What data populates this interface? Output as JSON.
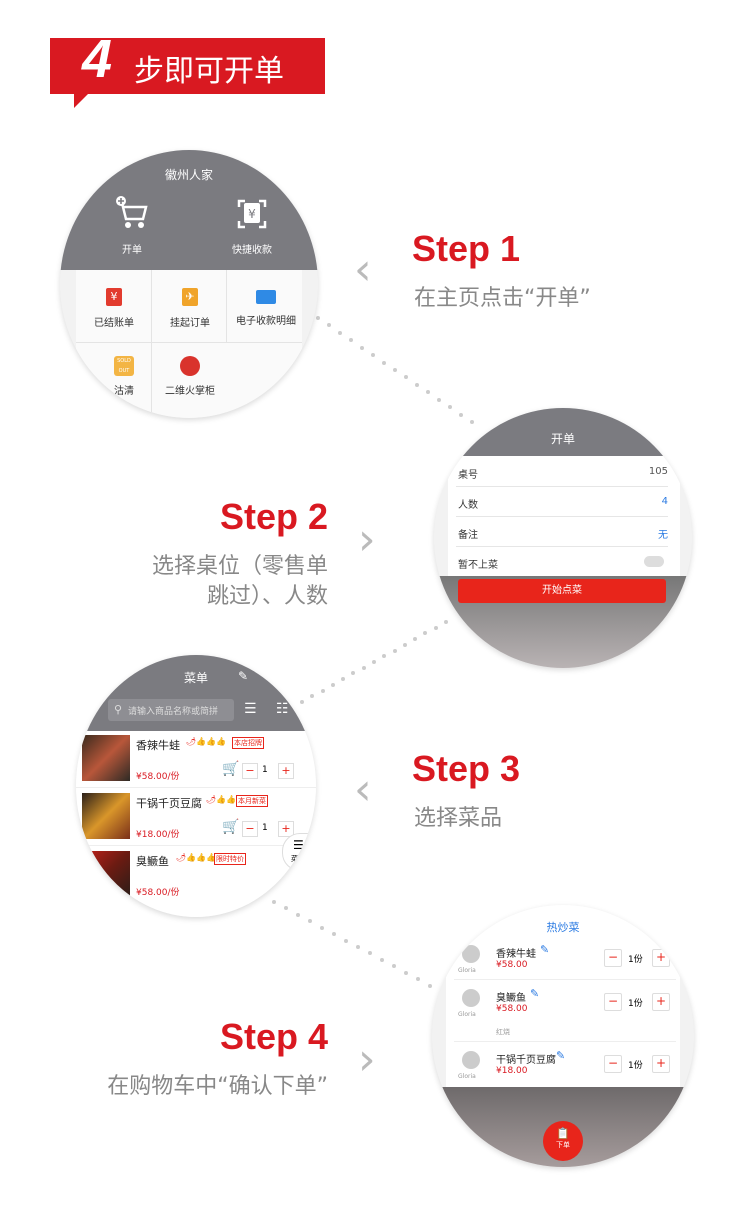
{
  "header": {
    "number": "4",
    "title": "步即可开单",
    "color": "#d91921"
  },
  "steps": [
    {
      "title": "Step 1",
      "desc": "在主页点击“开单”"
    },
    {
      "title": "Step 2",
      "desc_line1": "选择桌位（零售单",
      "desc_line2": "跳过）、人数"
    },
    {
      "title": "Step 3",
      "desc": "选择菜品"
    },
    {
      "title": "Step 4",
      "desc": "在购物车中“确认下单”"
    }
  ],
  "screen1": {
    "store_name": "徽州人家",
    "actions": [
      {
        "label": "开单",
        "icon": "cart-icon"
      },
      {
        "label": "快捷收款",
        "icon": "scan-yuan-icon"
      }
    ],
    "tiles": [
      {
        "label": "已结账单",
        "icon": "yuan-bill-icon"
      },
      {
        "label": "挂起订单",
        "icon": "pin-order-icon"
      },
      {
        "label": "电子收款明细",
        "icon": "card-icon"
      },
      {
        "label": "沽清",
        "icon": "sold-out-icon"
      },
      {
        "label": "二维火掌柜",
        "icon": "fire-icon"
      }
    ],
    "sold_out_text": "SOLD OUT"
  },
  "screen2": {
    "title": "开单",
    "rows": [
      {
        "label": "桌号",
        "value": "105"
      },
      {
        "label": "人数",
        "value": "4"
      },
      {
        "label": "备注",
        "value": "无"
      },
      {
        "label": "暂不上菜",
        "value": ""
      }
    ],
    "button": "开始点菜"
  },
  "screen3": {
    "title": "菜单",
    "search_placeholder": "请输入商品名称或简拼",
    "dishes": [
      {
        "name": "香辣牛蛙",
        "tag": "本店招牌",
        "price": "¥58.00/份",
        "qty": "1"
      },
      {
        "name": "干锅千页豆腐",
        "tag": "本月新菜",
        "price": "¥18.00/份",
        "qty": "1"
      },
      {
        "name": "臭鳜鱼",
        "tag": "限时特价",
        "price": "¥58.00/份",
        "qty": ""
      }
    ],
    "side_label": "菜类"
  },
  "screen4": {
    "category": "热炒菜",
    "sub_label": "红烧",
    "user": "Gloria",
    "items": [
      {
        "name": "香辣牛蛙",
        "price": "¥58.00",
        "qty": "1份"
      },
      {
        "name": "臭鳜鱼",
        "price": "¥58.00",
        "qty": "1份"
      },
      {
        "name": "干锅千页豆腐",
        "price": "¥18.00",
        "qty": "1份"
      }
    ],
    "order_button": "下单"
  }
}
